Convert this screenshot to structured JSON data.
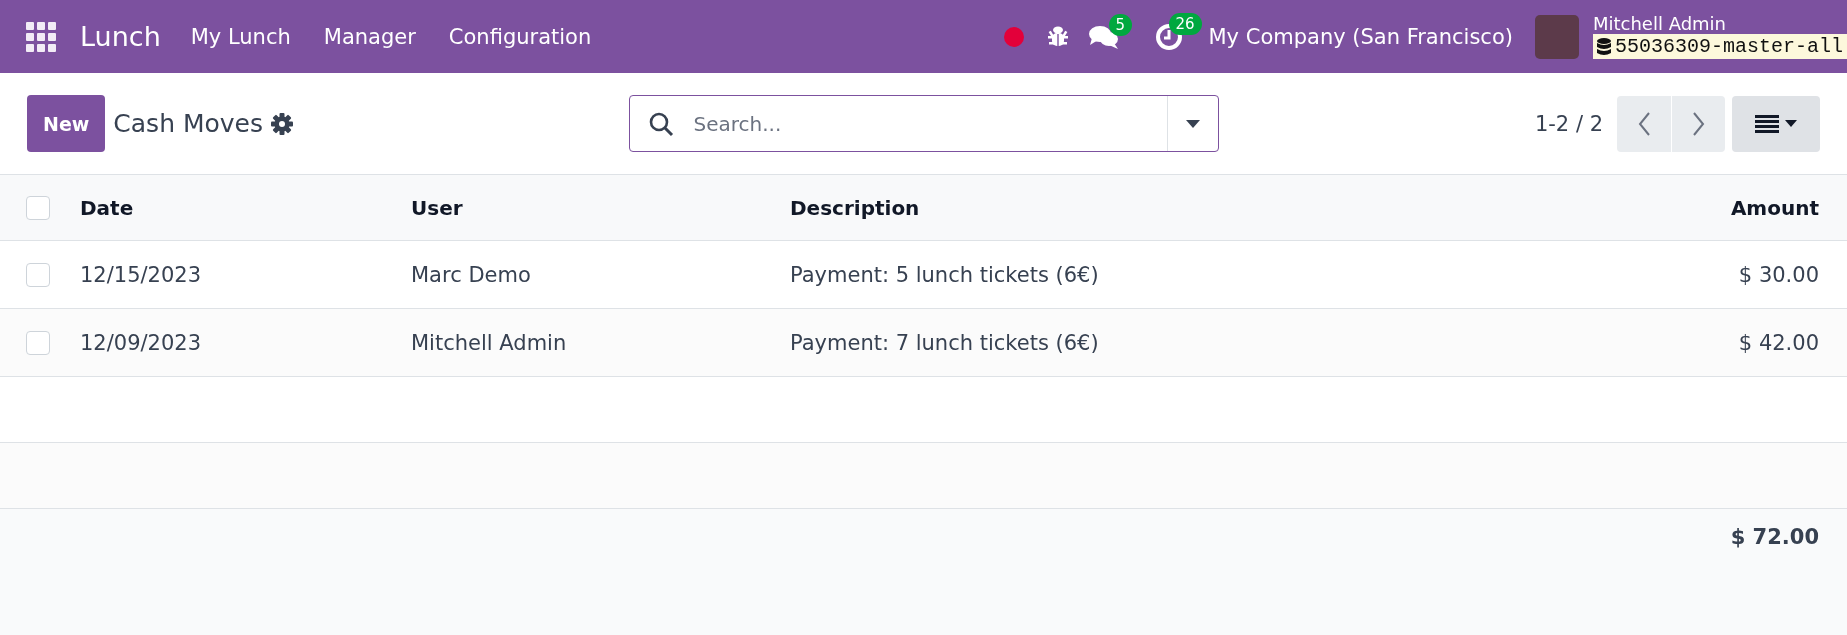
{
  "navbar": {
    "app_name": "Lunch",
    "menu": [
      "My Lunch",
      "Manager",
      "Configuration"
    ],
    "messages_count": "5",
    "activities_count": "26",
    "company": "My Company (San Francisco)",
    "user_name": "Mitchell Admin",
    "database": "55036309-master-all"
  },
  "control_panel": {
    "new_button": "New",
    "title": "Cash Moves",
    "search": {
      "placeholder": "Search..."
    },
    "pager": "1-2 / 2"
  },
  "table": {
    "select_all": {
      "checked": false
    },
    "columns": [
      "Date",
      "User",
      "Description",
      "Amount"
    ],
    "rows": [
      {
        "selected": false,
        "cells": [
          "12/15/2023",
          "Marc Demo",
          "Payment: 5 lunch tickets (6€)",
          "$ 30.00"
        ]
      },
      {
        "selected": false,
        "cells": [
          "12/09/2023",
          "Mitchell Admin",
          "Payment: 7 lunch tickets (6€)",
          "$ 42.00"
        ]
      }
    ],
    "total": "$ 72.00"
  }
}
